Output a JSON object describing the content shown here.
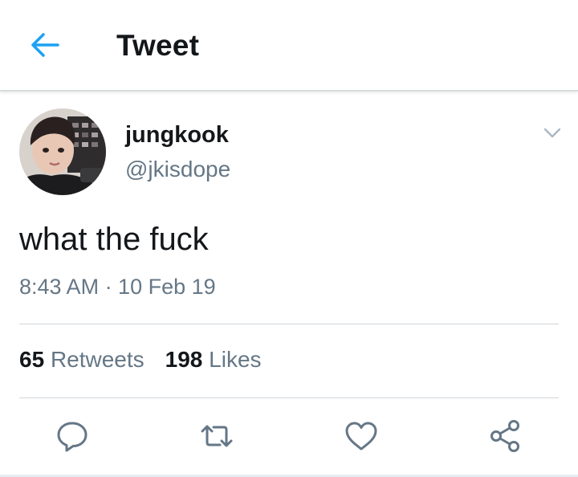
{
  "header": {
    "title": "Tweet",
    "back_icon": "arrow-left-icon"
  },
  "tweet": {
    "display_name": "jungkook",
    "handle": "@jkisdope",
    "text": "what the fuck",
    "timestamp": "8:43 AM · 10 Feb 19",
    "menu_icon": "chevron-down-icon"
  },
  "stats": {
    "retweets_count": "65",
    "retweets_label": "Retweets",
    "likes_count": "198",
    "likes_label": "Likes"
  },
  "actions": [
    {
      "name": "reply-icon"
    },
    {
      "name": "retweet-icon"
    },
    {
      "name": "like-icon"
    },
    {
      "name": "share-icon"
    }
  ],
  "colors": {
    "accent": "#1da1f2",
    "primary_text": "#14171a",
    "secondary_text": "#657786",
    "divider": "#cfd5da"
  }
}
